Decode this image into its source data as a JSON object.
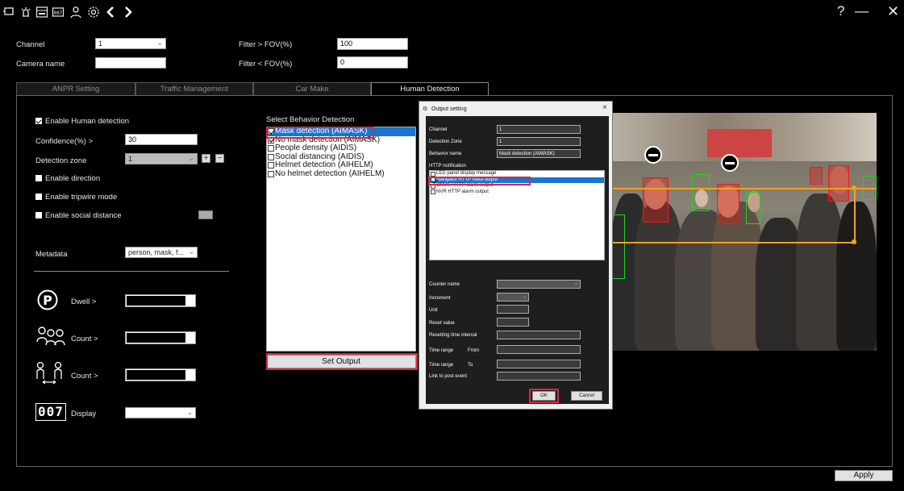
{
  "toolbar": {
    "icons": [
      "screen-icon",
      "alarm-icon",
      "device-icon",
      "counter-icon",
      "user-icon",
      "settings-icon",
      "back-icon",
      "forward-icon"
    ],
    "help": "?",
    "minimize": "—",
    "close": "✕"
  },
  "top": {
    "channel_label": "Channel",
    "channel_value": "1",
    "camera_name_label": "Camera name",
    "camera_name_value": "",
    "filter_gt_label": "Filter > FOV(%)",
    "filter_gt_value": "100",
    "filter_lt_label": "Filter < FOV(%)",
    "filter_lt_value": "0"
  },
  "tabs": [
    {
      "label": "ANPR Setting",
      "active": false
    },
    {
      "label": "Traffic Management",
      "active": false
    },
    {
      "label": "Car Make",
      "active": false
    },
    {
      "label": "Human Detection",
      "active": true
    }
  ],
  "left": {
    "enable_human": "Enable Human detection",
    "confidence_label": "Confidence(%) >",
    "confidence_value": "30",
    "zone_label": "Detection zone",
    "zone_value": "1",
    "plus": "+",
    "minus": "−",
    "enable_direction": "Enable direction",
    "enable_tripwire": "Enable tripwire mode",
    "enable_social": "Enable social distance",
    "metadata_label": "Metadata",
    "metadata_value": "person, mask, f...",
    "dwell_label": "Dwell >",
    "count1_label": "Count >",
    "count2_label": "Count >",
    "display_label": "Display",
    "counter_digits": "007"
  },
  "behavior": {
    "title": "Select Behavior Detection",
    "items": [
      {
        "label": "Mask detection (AIMASK)",
        "checked": true,
        "selected": true
      },
      {
        "label": "No mask detection (AIMASK)",
        "checked": true,
        "selected": false
      },
      {
        "label": "People density (AIDIS)",
        "checked": false,
        "selected": false
      },
      {
        "label": "Social distancing (AIDIS)",
        "checked": false,
        "selected": false
      },
      {
        "label": "Helmet detection (AIHELM)",
        "checked": false,
        "selected": false
      },
      {
        "label": "No helmet detection (AIHELM)",
        "checked": false,
        "selected": false
      }
    ],
    "set_output": "Set Output"
  },
  "dialog": {
    "title": "Output setting",
    "close": "×",
    "channel_label": "Channel",
    "channel_value": "1",
    "zone_label": "Detection Zone",
    "zone_value": "1",
    "behavior_label": "Behavior name",
    "behavior_value": "Mask detection (AIMASK)",
    "http_label": "HTTP notification",
    "notifications": [
      {
        "label": "LED panel display message",
        "checked": false,
        "selected": false
      },
      {
        "label": "Navigator HTTP meta output",
        "checked": true,
        "selected": true
      },
      {
        "label": "ONVIF HTTP alarm output",
        "checked": false,
        "selected": false
      },
      {
        "label": "NVR HTTP alarm output",
        "checked": false,
        "selected": false
      }
    ],
    "counter_name_label": "Counter name",
    "increment_label": "Increment",
    "unit_label": "Unit",
    "reset_label": "Reset value",
    "resetting_label": "Resetting time interval",
    "time_from_label": "Time range",
    "from": "From",
    "time_to_label": "Time range",
    "to": "To",
    "link_label": "Link to post event",
    "ok": "OK",
    "cancel": "Cancel"
  },
  "apply": "Apply",
  "colors": {
    "accent": "#1a74d4",
    "highlight": "#e0273a",
    "mask_box": "#21d321",
    "nomask_box": "#ee1b1b",
    "tripwire": "#f3a21a"
  }
}
